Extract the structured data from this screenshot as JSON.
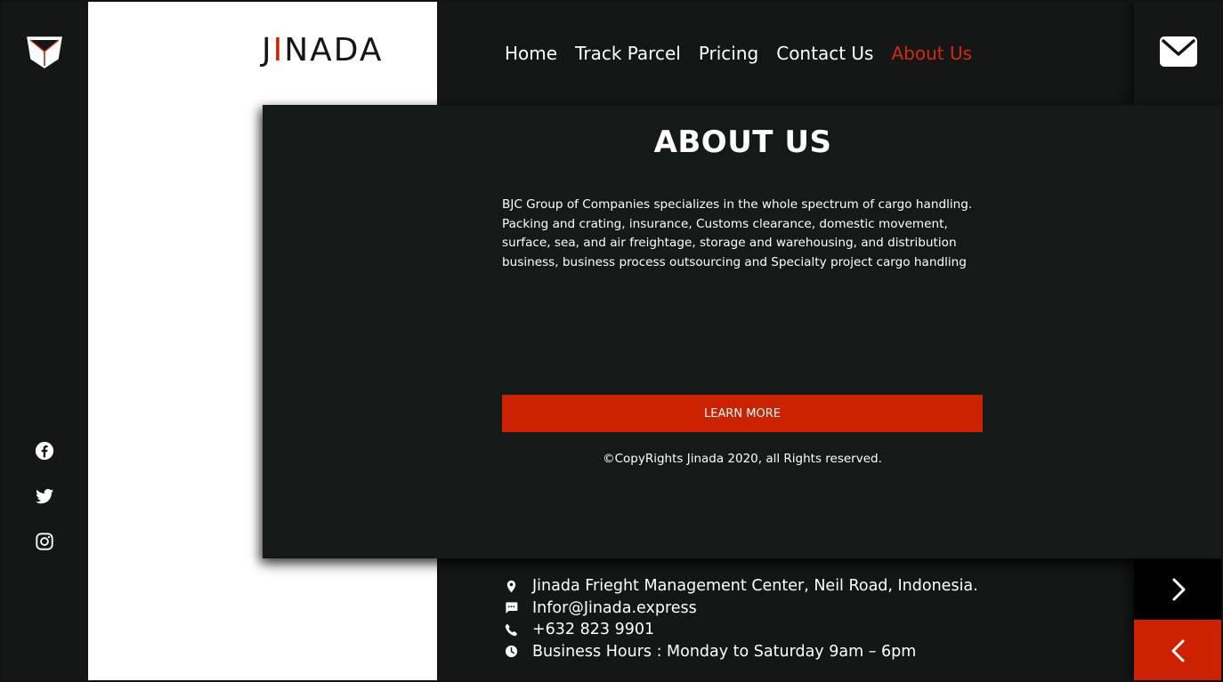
{
  "brand": {
    "prefix": "J",
    "accent": "I",
    "suffix": "NADA"
  },
  "nav": {
    "items": [
      {
        "label": "Home",
        "active": false
      },
      {
        "label": "Track Parcel",
        "active": false
      },
      {
        "label": "Pricing",
        "active": false
      },
      {
        "label": "Contact Us",
        "active": false
      },
      {
        "label": "About Us",
        "active": true
      }
    ]
  },
  "about": {
    "title": "ABOUT US",
    "text": "BJC Group of Companies specializes in the whole spectrum of cargo handling. Packing and crating, insurance, Customs clearance, domestic movement, surface, sea, and air freightage, storage and warehousing, and distribution business, business process outsourcing and Specialty project cargo handling",
    "button_label": "LEARN MORE",
    "copyright": "©CopyRights Jinada 2020, all Rights reserved."
  },
  "contact": {
    "address": "Jinada Frieght Management Center, Neil Road, Indonesia.",
    "email": "Infor@Jinada.express",
    "phone": "+632 823 9901",
    "hours": "Business Hours : Monday to Saturday 9am – 6pm"
  },
  "icons": {
    "logo": "cube-logo-icon",
    "mail": "mail-icon",
    "social": [
      "facebook-icon",
      "twitter-icon",
      "instagram-icon"
    ],
    "contact": [
      "location-pin-icon",
      "chat-icon",
      "phone-icon",
      "clock-icon"
    ],
    "next": "chevron-right-icon",
    "prev": "chevron-left-icon"
  },
  "colors": {
    "accent": "#cc2200",
    "nav_active": "#d42a10",
    "dark": "#141716",
    "white": "#ffffff"
  }
}
